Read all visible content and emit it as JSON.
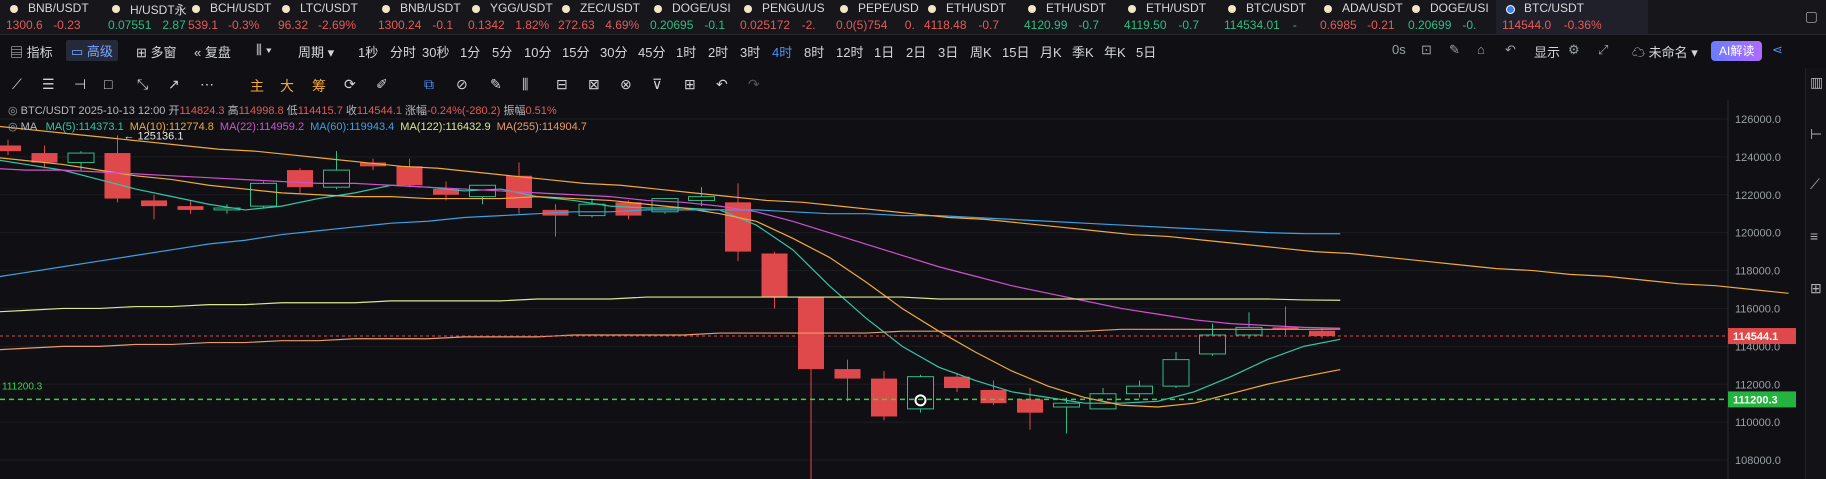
{
  "tabs": [
    {
      "name": "BNB/USDT",
      "price": "1300.6",
      "chg": "-0.23",
      "dir": "down"
    },
    {
      "name": "H/USDT永",
      "price": "0.07551",
      "chg": "2.87",
      "dir": "up"
    },
    {
      "name": "BCH/USDT",
      "price": "539.1",
      "chg": "-0.3%",
      "dir": "down"
    },
    {
      "name": "LTC/USDT",
      "price": "96.32",
      "chg": "-2.69%",
      "dir": "down"
    },
    {
      "name": "BNB/USDT",
      "price": "1300.24",
      "chg": "-0.1",
      "dir": "down"
    },
    {
      "name": "YGG/USDT",
      "price": "0.1342",
      "chg": "1.82%",
      "dir": "down"
    },
    {
      "name": "ZEC/USDT",
      "price": "272.63",
      "chg": "4.69%",
      "dir": "down"
    },
    {
      "name": "DOGE/USI",
      "price": "0.20695",
      "chg": "-0.1",
      "dir": "up"
    },
    {
      "name": "PENGU/US",
      "price": "0.025172",
      "chg": "-2.",
      "dir": "down"
    },
    {
      "name": "PEPE/USD",
      "price": "0.0(5)754",
      "chg": "0.",
      "dir": "down"
    },
    {
      "name": "ETH/USDT",
      "price": "4118.48",
      "chg": "-0.7",
      "dir": "down"
    },
    {
      "name": "ETH/USDT",
      "price": "4120.99",
      "chg": "-0.7",
      "dir": "up"
    },
    {
      "name": "ETH/USDT",
      "price": "4119.50",
      "chg": "-0.7",
      "dir": "up"
    },
    {
      "name": "BTC/USDT",
      "price": "114534.01",
      "chg": "-",
      "dir": "up"
    },
    {
      "name": "ADA/USDT",
      "price": "0.6985",
      "chg": "-0.21",
      "dir": "down"
    },
    {
      "name": "DOGE/USI",
      "price": "0.20699",
      "chg": "-0.",
      "dir": "up"
    },
    {
      "name": "BTC/USDT",
      "price": "114544.0",
      "chg": "-0.36%",
      "dir": "down",
      "active": true
    }
  ],
  "toolbar": {
    "indicator": "指标",
    "advanced": "高级",
    "multi_window": "多窗",
    "replay": "复盘",
    "period": "周期",
    "periods": [
      "1秒",
      "分时",
      "30秒",
      "1分",
      "5分",
      "10分",
      "15分",
      "30分",
      "45分",
      "1时",
      "2时",
      "3时",
      "4时",
      "8时",
      "12时",
      "1日",
      "2日",
      "3日",
      "周K",
      "15日",
      "月K",
      "季K",
      "年K",
      "5日"
    ],
    "active_period": "4时",
    "right_0s": "0s",
    "display": "显示",
    "unnamed": "未命名",
    "ai_read": "AI解读"
  },
  "drawing_tools": {
    "main": "主",
    "big": "大",
    "chip": "筹"
  },
  "legend": {
    "symbol": "BTC/USDT",
    "datetime": "2025-10-13 12:00",
    "open_label": "开",
    "open": "114824.3",
    "high_label": "高",
    "high": "114998.8",
    "low_label": "低",
    "low": "114415.7",
    "close_label": "收",
    "close": "114544.1",
    "chg_label": "涨幅",
    "chg": "-0.24%(-280.2)",
    "amp_label": "振幅",
    "amp": "0.51%",
    "ma_label": "MA",
    "ma": [
      {
        "text": "MA(5):114373.1",
        "color": "#33c6a6"
      },
      {
        "text": "MA(10):112774.8",
        "color": "#f0a93c"
      },
      {
        "text": "MA(22):114959.2",
        "color": "#d050d0"
      },
      {
        "text": "MA(60):119943.4",
        "color": "#3ea0e0"
      },
      {
        "text": "MA(122):116432.9",
        "color": "#d8e890"
      },
      {
        "text": "MA(255):114904.7",
        "color": "#e79b6a"
      }
    ]
  },
  "chart_data": {
    "type": "candlestick",
    "symbol": "BTC/USDT",
    "interval": "4时",
    "ylim": [
      107000,
      127000
    ],
    "yticks": [
      108000,
      110000,
      112000,
      114000,
      116000,
      118000,
      120000,
      122000,
      124000,
      126000
    ],
    "last_price_label": "114544.1",
    "alert_line_label": "111200.3",
    "alert_line_value": 111200.3,
    "high_annotation": "← 125136.1",
    "high_annotation_value": 125136.1,
    "candles": [
      {
        "o": 124600,
        "h": 124900,
        "l": 124100,
        "c": 124300
      },
      {
        "o": 124200,
        "h": 124600,
        "l": 123400,
        "c": 123700
      },
      {
        "o": 123700,
        "h": 124300,
        "l": 123300,
        "c": 124200
      },
      {
        "o": 124200,
        "h": 125136,
        "l": 121600,
        "c": 121800
      },
      {
        "o": 121700,
        "h": 122000,
        "l": 120700,
        "c": 121400
      },
      {
        "o": 121400,
        "h": 121700,
        "l": 121000,
        "c": 121200
      },
      {
        "o": 121200,
        "h": 121500,
        "l": 121000,
        "c": 121300
      },
      {
        "o": 121400,
        "h": 122700,
        "l": 121300,
        "c": 122600
      },
      {
        "o": 123300,
        "h": 123400,
        "l": 122100,
        "c": 122400
      },
      {
        "o": 122400,
        "h": 124300,
        "l": 122300,
        "c": 123300
      },
      {
        "o": 123700,
        "h": 123900,
        "l": 123300,
        "c": 123500
      },
      {
        "o": 123500,
        "h": 123900,
        "l": 122400,
        "c": 122500
      },
      {
        "o": 122300,
        "h": 122700,
        "l": 121700,
        "c": 122000
      },
      {
        "o": 121900,
        "h": 122500,
        "l": 121500,
        "c": 122500
      },
      {
        "o": 123000,
        "h": 123700,
        "l": 121000,
        "c": 121300
      },
      {
        "o": 121200,
        "h": 121500,
        "l": 119800,
        "c": 120900
      },
      {
        "o": 120900,
        "h": 121800,
        "l": 120800,
        "c": 121500
      },
      {
        "o": 121600,
        "h": 121700,
        "l": 120700,
        "c": 120900
      },
      {
        "o": 121100,
        "h": 121800,
        "l": 121000,
        "c": 121800
      },
      {
        "o": 121700,
        "h": 122400,
        "l": 121400,
        "c": 121900
      },
      {
        "o": 121600,
        "h": 122600,
        "l": 118500,
        "c": 119000
      },
      {
        "o": 118900,
        "h": 119000,
        "l": 116000,
        "c": 116600
      },
      {
        "o": 116600,
        "h": 116600,
        "l": 103000,
        "c": 112800
      },
      {
        "o": 112800,
        "h": 113300,
        "l": 111100,
        "c": 112300
      },
      {
        "o": 112300,
        "h": 112700,
        "l": 110100,
        "c": 110300
      },
      {
        "o": 110700,
        "h": 112500,
        "l": 110500,
        "c": 112400
      },
      {
        "o": 112400,
        "h": 112600,
        "l": 111600,
        "c": 111800
      },
      {
        "o": 111700,
        "h": 112200,
        "l": 110900,
        "c": 111000
      },
      {
        "o": 111200,
        "h": 111800,
        "l": 109600,
        "c": 110500
      },
      {
        "o": 110800,
        "h": 111300,
        "l": 109400,
        "c": 111000
      },
      {
        "o": 110700,
        "h": 111800,
        "l": 110700,
        "c": 111500
      },
      {
        "o": 111500,
        "h": 112200,
        "l": 111300,
        "c": 111900
      },
      {
        "o": 111900,
        "h": 113700,
        "l": 111800,
        "c": 113300
      },
      {
        "o": 113600,
        "h": 115200,
        "l": 113500,
        "c": 114600
      },
      {
        "o": 114600,
        "h": 115800,
        "l": 114400,
        "c": 115000
      },
      {
        "o": 115000,
        "h": 116100,
        "l": 114600,
        "c": 114900
      },
      {
        "o": 114824,
        "h": 114999,
        "l": 114416,
        "c": 114544
      }
    ],
    "ma_series": [
      {
        "name": "MA(5)",
        "color": "#33c6a6",
        "start": 1,
        "values": [
          123900,
          123600,
          123300,
          122800,
          122300,
          121900,
          121500,
          121200,
          121400,
          121800,
          122100,
          122500,
          122400,
          122200,
          122300,
          121900,
          121700,
          121400,
          121300,
          121300,
          121200,
          120400,
          119100,
          117200,
          115500,
          114000,
          112900,
          112200,
          111600,
          111300,
          111000,
          111000,
          111100,
          111600,
          112400,
          113300,
          114000,
          114373
        ]
      },
      {
        "name": "MA(10)",
        "color": "#f0a93c",
        "start": 0,
        "values": [
          124000,
          123800,
          123600,
          123300,
          123000,
          122800,
          122500,
          122300,
          122100,
          122000,
          121900,
          121900,
          121800,
          121800,
          121800,
          121900,
          121800,
          121700,
          121500,
          121300,
          121000,
          120600,
          119700,
          118700,
          117400,
          116000,
          114800,
          113700,
          112700,
          111900,
          111300,
          110900,
          110800,
          111000,
          111500,
          112000,
          112400,
          112775
        ]
      },
      {
        "name": "MA(22)",
        "color": "#d050d0",
        "start": 0,
        "values": [
          123400,
          123300,
          123300,
          123200,
          123100,
          123000,
          122900,
          122800,
          122700,
          122600,
          122600,
          122500,
          122400,
          122300,
          122200,
          122100,
          122000,
          121900,
          121700,
          121600,
          121400,
          121100,
          120600,
          120000,
          119400,
          118800,
          118200,
          117700,
          117200,
          116800,
          116400,
          116000,
          115700,
          115400,
          115200,
          115100,
          115000,
          114959
        ]
      },
      {
        "name": "MA(60)",
        "color": "#3ea0e0",
        "start": 0,
        "values": [
          117600,
          117900,
          118200,
          118500,
          118800,
          119100,
          119400,
          119600,
          119900,
          120100,
          120300,
          120500,
          120600,
          120800,
          120900,
          121000,
          121100,
          121100,
          121200,
          121200,
          121200,
          121200,
          121100,
          121000,
          121000,
          120900,
          120900,
          120800,
          120700,
          120600,
          120500,
          120400,
          120300,
          120200,
          120100,
          120000,
          119950,
          119943
        ]
      },
      {
        "name": "MA(122)",
        "color": "#d8e890",
        "start": 0,
        "values": [
          115800,
          115900,
          116000,
          116000,
          116100,
          116100,
          116200,
          116200,
          116300,
          116300,
          116300,
          116400,
          116400,
          116400,
          116400,
          116500,
          116500,
          116500,
          116600,
          116600,
          116600,
          116600,
          116600,
          116600,
          116600,
          116600,
          116500,
          116500,
          116500,
          116500,
          116500,
          116500,
          116500,
          116500,
          116500,
          116500,
          116450,
          116433
        ]
      },
      {
        "name": "MA(255)",
        "color": "#e79b6a",
        "start": 0,
        "values": [
          113800,
          113900,
          114000,
          114000,
          114100,
          114100,
          114200,
          114200,
          114300,
          114300,
          114400,
          114400,
          114400,
          114500,
          114500,
          114500,
          114600,
          114600,
          114600,
          114600,
          114700,
          114700,
          114700,
          114700,
          114700,
          114800,
          114800,
          114800,
          114800,
          114800,
          114800,
          114900,
          114900,
          114900,
          114900,
          114900,
          114900,
          114905
        ]
      },
      {
        "name": "trend",
        "color": "#f0a93c",
        "start": 0,
        "values": [
          125600,
          125400,
          125200,
          125000,
          124800,
          124600,
          124400,
          124300,
          124100,
          123900,
          123700,
          123500,
          123400,
          123200,
          123000,
          122800,
          122600,
          122500,
          122300,
          122100,
          121900,
          121700,
          121600,
          121400,
          121200,
          121000,
          120800,
          120700,
          120500,
          120300,
          120100,
          119900,
          119800,
          119600,
          119400,
          119200,
          119000,
          118900,
          118700,
          118500,
          118300,
          118100,
          118000,
          117800,
          117700,
          117500,
          117300,
          117200,
          117000,
          116800
        ]
      }
    ]
  }
}
